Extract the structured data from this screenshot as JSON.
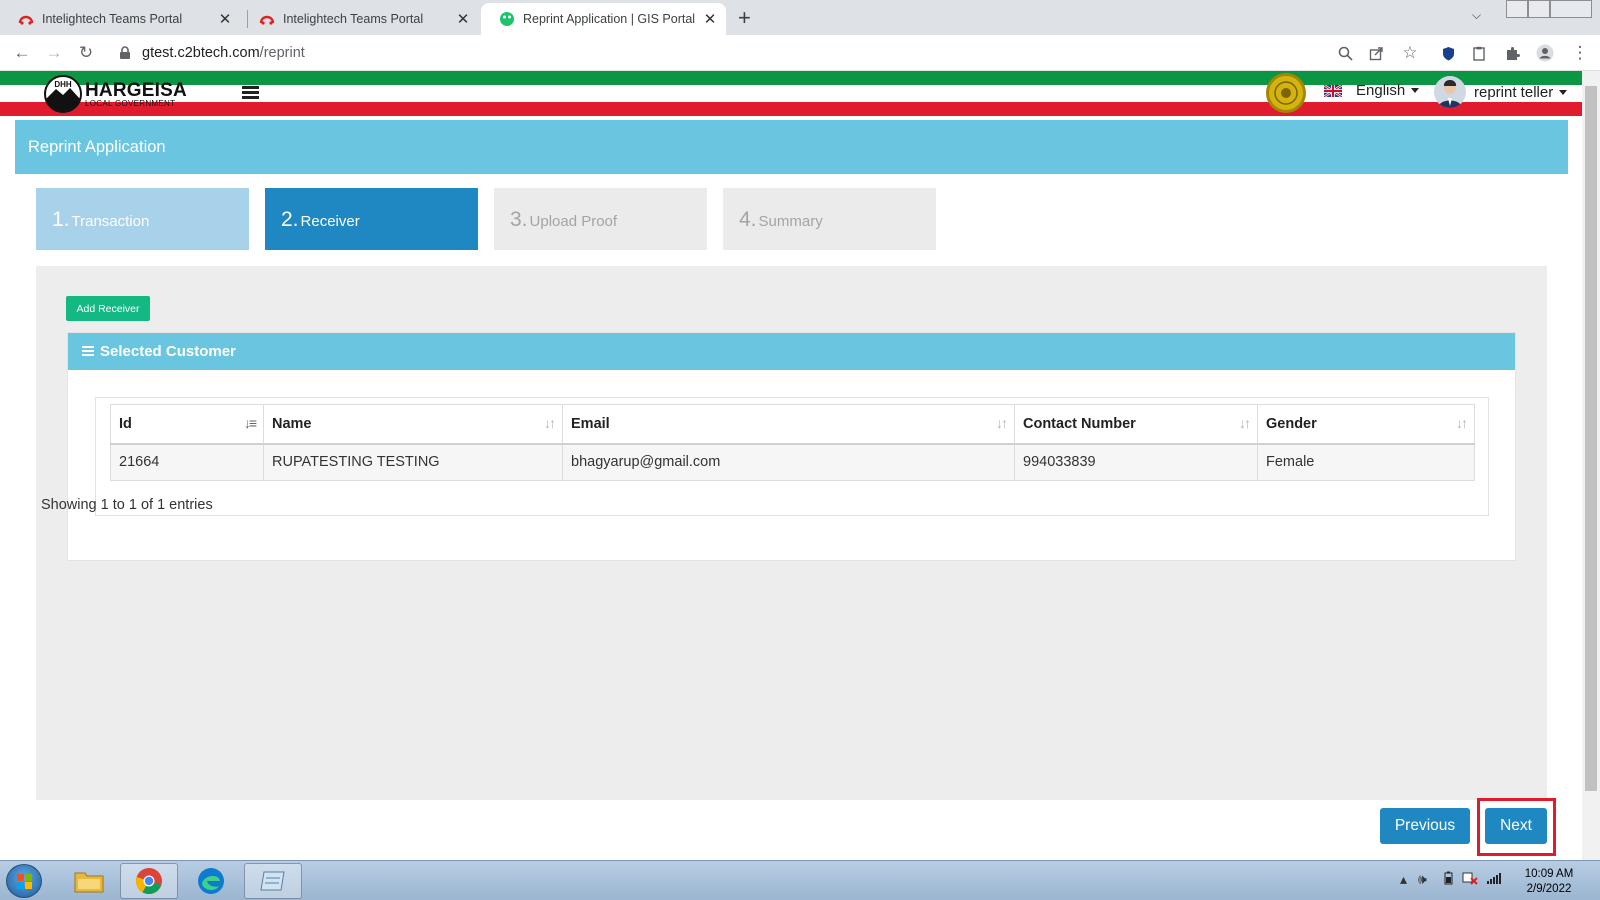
{
  "browser": {
    "tabs": [
      {
        "title": "Intelightech Teams Portal",
        "active": false
      },
      {
        "title": "Intelightech Teams Portal",
        "active": false
      },
      {
        "title": "Reprint Application | GIS Portal",
        "active": true
      }
    ],
    "new_tab_symbol": "+",
    "url_host": "gtest.c2btech.com",
    "url_path": "/reprint"
  },
  "header": {
    "logo_title": "HARGEISA",
    "logo_subtitle": "LOCAL GOVERNMENT",
    "logo_badge": "DHH",
    "language": "English",
    "username": "reprint teller"
  },
  "page": {
    "title": "Reprint Application",
    "steps": [
      {
        "num": "1.",
        "label": "Transaction",
        "state": "done"
      },
      {
        "num": "2.",
        "label": "Receiver",
        "state": "current"
      },
      {
        "num": "3.",
        "label": "Upload Proof",
        "state": "todo"
      },
      {
        "num": "4.",
        "label": "Summary",
        "state": "todo"
      }
    ],
    "add_receiver_label": "Add Receiver",
    "card_title": "Selected Customer",
    "table": {
      "columns": [
        "Id",
        "Name",
        "Email",
        "Contact Number",
        "Gender"
      ],
      "rows": [
        [
          "21664",
          "RUPATESTING TESTING",
          "bhagyarup@gmail.com",
          "994033839",
          "Female"
        ]
      ]
    },
    "info": "Showing 1 to 1 of 1 entries",
    "previous_label": "Previous",
    "next_label": "Next"
  },
  "taskbar": {
    "time": "10:09 AM",
    "date": "2/9/2022"
  },
  "colors": {
    "accent": "#1f88c3",
    "title_bar": "#6ac5e0",
    "add_button": "#13b882",
    "flag_green": "#0a9642",
    "flag_red": "#e01b2e"
  }
}
